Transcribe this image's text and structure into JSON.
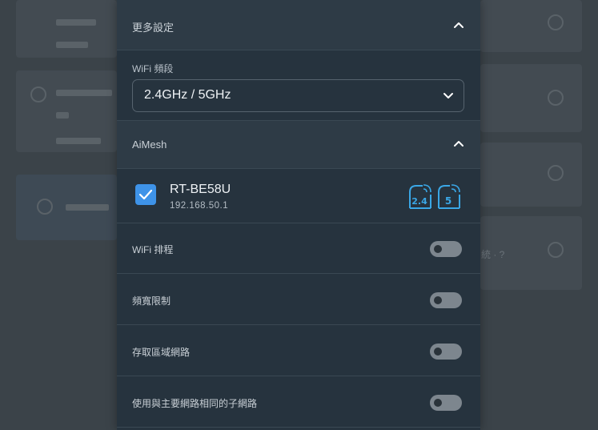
{
  "background": {
    "right_text": "統 · ?"
  },
  "more_settings": {
    "title": "更多設定"
  },
  "wifi_band": {
    "label": "WiFi 頻段",
    "value": "2.4GHz / 5GHz"
  },
  "aimesh": {
    "title": "AiMesh",
    "devices": [
      {
        "name": "RT-BE58U",
        "ip": "192.168.50.1",
        "checked": true,
        "bands": [
          "2.4",
          "5"
        ]
      }
    ]
  },
  "toggles": [
    {
      "label": "WiFi 排程",
      "on": false
    },
    {
      "label": "頻寬限制",
      "on": false
    },
    {
      "label": "存取區域網路",
      "on": false
    },
    {
      "label": "使用與主要網路相同的子網路",
      "on": false
    }
  ],
  "colors": {
    "accent": "#3e93e8",
    "band_icon": "#3aa7e6",
    "panel_bg": "#26333e",
    "header_bg": "#2e3b46"
  }
}
